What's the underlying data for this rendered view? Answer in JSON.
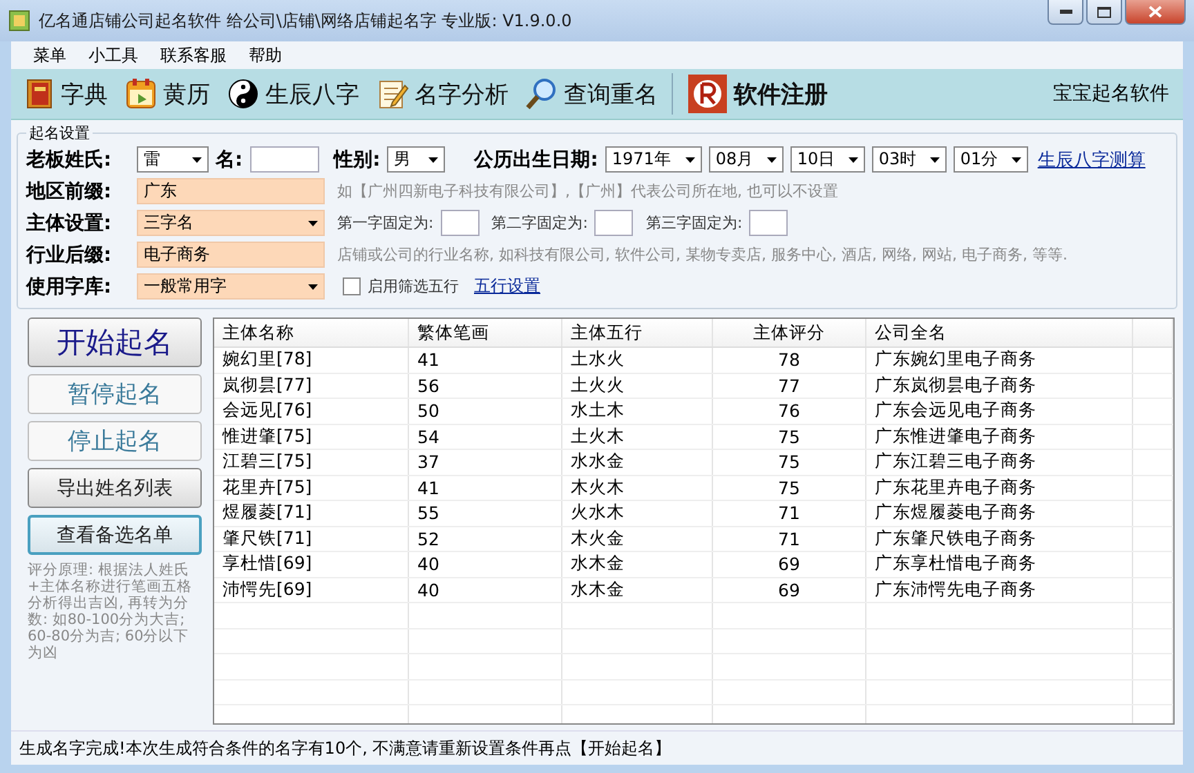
{
  "window": {
    "title": "亿名通店铺公司起名软件 给公司\\店铺\\网络店铺起名字  专业版: V1.9.0.0"
  },
  "menu": [
    "菜单",
    "小工具",
    "联系客服",
    "帮助"
  ],
  "toolbar": {
    "items": [
      {
        "label": "字典",
        "kind": "normal"
      },
      {
        "label": "黄历",
        "kind": "normal"
      },
      {
        "label": "生辰八字",
        "kind": "normal"
      },
      {
        "label": "名字分析",
        "kind": "normal"
      },
      {
        "label": "查询重名",
        "kind": "normal"
      },
      {
        "label": "软件注册",
        "kind": "register"
      }
    ],
    "right_label": "宝宝起名软件"
  },
  "settings": {
    "title": "起名设置",
    "surname": {
      "label": "老板姓氏:",
      "value": "雷"
    },
    "given_name": {
      "label": "名:"
    },
    "gender": {
      "label": "性别:",
      "value": "男"
    },
    "birth_date": {
      "label": "公历出生日期:",
      "selects": [
        "1971年",
        "08月",
        "10日",
        "03时",
        "01分"
      ]
    },
    "bazi_link": "生辰八字测算",
    "region": {
      "label": "地区前缀:",
      "value": "广东",
      "hint": "如【广州四新电子科技有限公司】,【广州】代表公司所在地, 也可以不设置"
    },
    "subject": {
      "label": "主体设置:",
      "value": "三字名",
      "fixed": [
        "第一字固定为:",
        "第二字固定为:",
        "第三字固定为:"
      ]
    },
    "industry": {
      "label": "行业后缀:",
      "value": "电子商务",
      "hint": "店铺或公司的行业名称, 如科技有限公司, 软件公司, 某物专卖店, 服务中心, 酒店, 网络, 网站, 电子商务, 等等."
    },
    "charset": {
      "label": "使用字库:",
      "value": "一般常用字",
      "filter": {
        "label": "启用筛选五行",
        "checked": false
      },
      "link": "五行设置"
    }
  },
  "buttons": [
    {
      "label": "开始起名",
      "kind": "primary"
    },
    {
      "label": "暂停起名",
      "kind": "inactive"
    },
    {
      "label": "停止起名",
      "kind": "inactive"
    },
    {
      "label": "导出姓名列表",
      "kind": "normal"
    },
    {
      "label": "查看备选名单",
      "kind": "focused"
    }
  ],
  "note": "评分原理: 根据法人姓氏+主体名称进行笔画五格分析得出吉凶, 再转为分数: 如80-100分为大吉; 60-80分为吉; 60分以下为凶",
  "table": {
    "columns": [
      "主体名称",
      "繁体笔画",
      "主体五行",
      "主体评分",
      "公司全名"
    ],
    "rows": [
      [
        "婉幻里[78]",
        "41",
        "土水火",
        "78",
        "广东婉幻里电子商务"
      ],
      [
        "岚彻昙[77]",
        "56",
        "土火火",
        "77",
        "广东岚彻昙电子商务"
      ],
      [
        "会远见[76]",
        "50",
        "水土木",
        "76",
        "广东会远见电子商务"
      ],
      [
        "惟进肇[75]",
        "54",
        "土火木",
        "75",
        "广东惟进肇电子商务"
      ],
      [
        "江碧三[75]",
        "37",
        "水水金",
        "75",
        "广东江碧三电子商务"
      ],
      [
        "花里卉[75]",
        "41",
        "木火木",
        "75",
        "广东花里卉电子商务"
      ],
      [
        "煜履菱[71]",
        "55",
        "火水木",
        "71",
        "广东煜履菱电子商务"
      ],
      [
        "肇尺铁[71]",
        "52",
        "木火金",
        "71",
        "广东肇尺铁电子商务"
      ],
      [
        "享杜惜[69]",
        "40",
        "水木金",
        "69",
        "广东享杜惜电子商务"
      ],
      [
        "沛愕先[69]",
        "40",
        "水木金",
        "69",
        "广东沛愕先电子商务"
      ]
    ]
  },
  "status_bar": "生成名字完成!本次生成符合条件的名字有10个, 不满意请重新设置条件再点【开始起名】"
}
